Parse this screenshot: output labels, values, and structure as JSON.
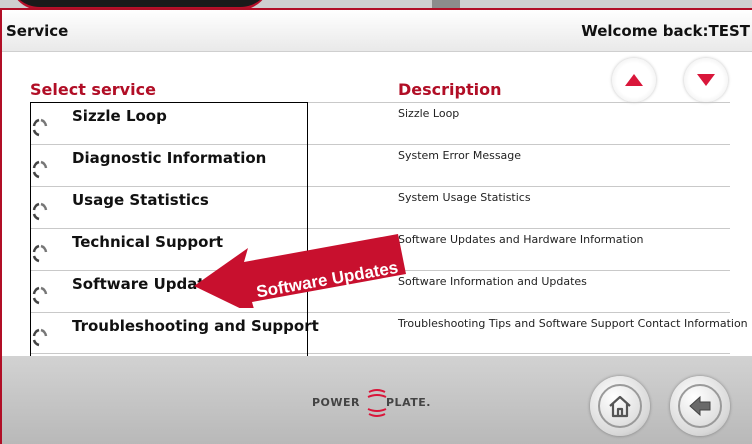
{
  "header": {
    "title": "Service",
    "welcome": "Welcome back:TEST"
  },
  "columns": {
    "service": "Select service",
    "description": "Description"
  },
  "services": [
    {
      "name": "Sizzle Loop",
      "description": "Sizzle Loop"
    },
    {
      "name": "Diagnostic Information",
      "description": "System Error Message"
    },
    {
      "name": "Usage Statistics",
      "description": "System Usage Statistics"
    },
    {
      "name": "Technical Support",
      "description": "Software Updates and Hardware Information"
    },
    {
      "name": "Software Updates",
      "description": "Software Information and Updates"
    },
    {
      "name": "Troubleshooting and Support",
      "description": "Troubleshooting Tips and Software Support Contact Information"
    }
  ],
  "callout": {
    "text": "Software Updates",
    "color": "#c8102e"
  },
  "footer": {
    "logo_left": "POWER",
    "logo_right": "PLATE."
  },
  "icons": {
    "scroll_up": "triangle-up-icon",
    "scroll_down": "triangle-down-icon",
    "home": "home-icon",
    "back": "back-arrow-icon",
    "row": "spinner-icon"
  },
  "colors": {
    "accent": "#b10e26",
    "arrow_red": "#d9163a"
  }
}
